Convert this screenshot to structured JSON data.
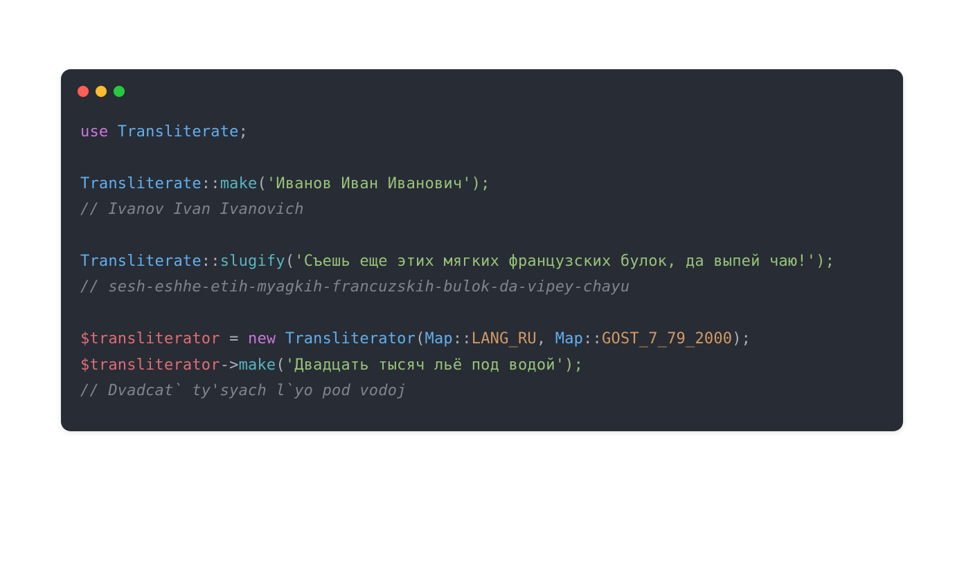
{
  "code": {
    "line1": {
      "use": "use",
      "space": " ",
      "class": "Transliterate",
      "semi": ";"
    },
    "line3": {
      "class": "Transliterate",
      "dcolon": "::",
      "method": "make",
      "open": "(",
      "q": "'",
      "str": "Иванов Иван Иванович",
      "close": "');"
    },
    "line4": {
      "comment": "// Ivanov Ivan Ivanovich"
    },
    "line6": {
      "class": "Transliterate",
      "dcolon": "::",
      "method": "slugify",
      "open": "(",
      "q": "'",
      "str": "Съешь еще этих мягких французских булок, да выпей чаю!",
      "close": "');"
    },
    "line7": {
      "comment": "// sesh-eshhe-etih-myagkih-francuzskih-bulok-da-vipey-chayu"
    },
    "line9": {
      "var": "$transliterator",
      "eq": " = ",
      "new": "new",
      "sp": " ",
      "class": "Transliterator",
      "open": "(",
      "map1": "Map",
      "dc1": "::",
      "const1": "LANG_RU",
      "comma": ", ",
      "map2": "Map",
      "dc2": "::",
      "const2": "GOST_7_79_2000",
      "close": ");"
    },
    "line10": {
      "var": "$transliterator",
      "arrow": "->",
      "method": "make",
      "open": "(",
      "q": "'",
      "str": "Двадцать тысяч льё под водой",
      "close": "');"
    },
    "line11": {
      "comment": "// Dvadcat` ty'syach l`yo pod vodoj"
    }
  }
}
